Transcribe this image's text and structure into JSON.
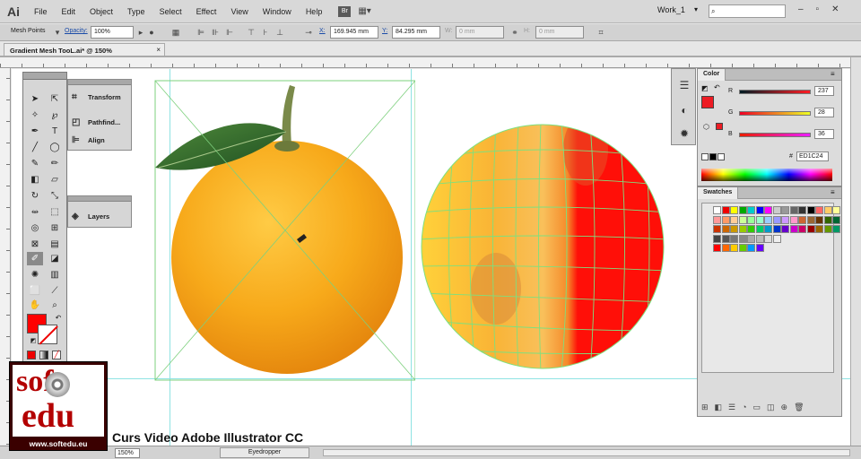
{
  "app": {
    "logo": "Ai",
    "workspace": "Work_1"
  },
  "menu": [
    "File",
    "Edit",
    "Object",
    "Type",
    "Select",
    "Effect",
    "View",
    "Window",
    "Help"
  ],
  "menu_icons": {
    "bridge": "Br",
    "arrange": "arrange-documents-icon"
  },
  "controlbar": {
    "tool_name": "Mesh Points",
    "opacity_label": "Opacity:",
    "opacity_value": "100%",
    "x_label": "X:",
    "x_value": "169.945 mm",
    "y_label": "Y:",
    "y_value": "84.295 mm",
    "w_label": "W:",
    "w_value": "0 mm",
    "h_label": "H:",
    "h_value": "0 mm"
  },
  "document": {
    "tab_title": "Gradient Mesh TooL.ai* @ 150% (RGB/Preview)",
    "close": "×"
  },
  "panels": {
    "transform": "Transform",
    "pathfinder": "Pathfind...",
    "align": "Align",
    "layers": "Layers"
  },
  "color_panel": {
    "tab": "Color",
    "r_label": "R",
    "r_value": "237",
    "g_label": "G",
    "g_value": "28",
    "b_label": "B",
    "b_value": "36",
    "hex_label": "#",
    "hex_value": "ED1C24",
    "fill_color": "#ed1c24"
  },
  "swatches_panel": {
    "tab": "Swatches"
  },
  "status": {
    "zoom": "150%",
    "tool": "Eyedropper"
  },
  "watermark": {
    "url": "www.softedu.eu",
    "brand_top": "soft",
    "brand_bottom": "edu"
  },
  "course_title": "Curs Video Adobe Illustrator CC"
}
